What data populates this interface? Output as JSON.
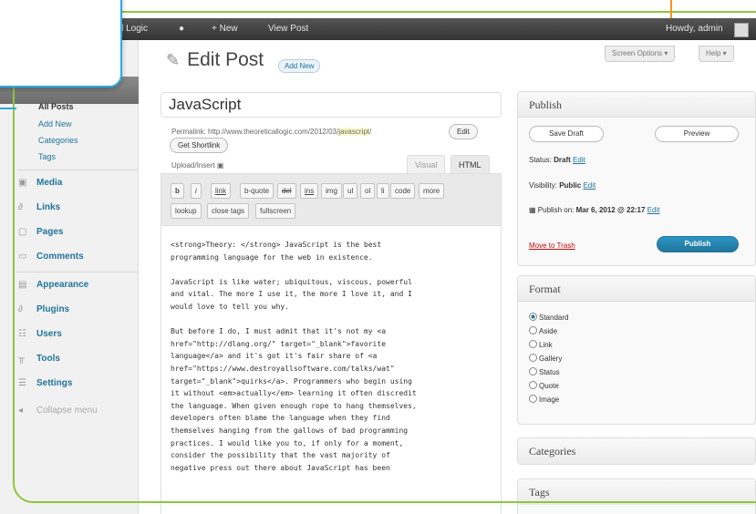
{
  "adminbar": {
    "site_name": "etical Logic",
    "comment_icon": "speech-bubble-icon",
    "new_label": "+ New",
    "view_post": "View Post",
    "howdy": "Howdy, admin"
  },
  "page": {
    "title": "Edit Post",
    "add_new": "Add New",
    "screen_options": "Screen Options ▾",
    "help": "Help ▾"
  },
  "post": {
    "title": "JavaScript",
    "permalink_prefix": "Permalink: http://www.theoreticallogic.com/2012/03/",
    "permalink_slug": "javascript",
    "permalink_suffix": "/",
    "edit_btn": "Edit",
    "shortlink_btn": "Get Shortlink",
    "upload_insert": "Upload/Insert",
    "tab_visual": "Visual",
    "tab_html": "HTML"
  },
  "quicktags": {
    "row1": [
      "b",
      "i",
      "link",
      "b-quote",
      "del",
      "ins",
      "img",
      "ul",
      "ol",
      "li",
      "code",
      "more"
    ],
    "row2": [
      "lookup",
      "close tags",
      "fullscreen"
    ]
  },
  "content": {
    "p1": "<strong>Theory: </strong> JavaScript is the best\nprogramming language for the web in existence.",
    "p2": "JavaScript is like water; ubiquitous, viscous, powerful\nand vital. The more I use it, the more I love it, and I\nwould love to tell you why.",
    "p3": "But before I do, I must admit that it's not my <a\nhref=\"http://dlang.org/\" target=\"_blank\">favorite\nlanguage</a> and it's got it's fair share of <a\nhref=\"https://www.destroyallsoftware.com/talks/wat\"\ntarget=\"_blank\">quirks</a>. Programmers who begin using\nit without <em>actually</em> learning it often discredit\nthe language. When given enough rope to hang themselves,\ndevelopers often blame the language when they find\nthemselves hanging from the gallows of bad programming\npractices. I would like you to, if only for a moment,\nconsider the possibility that the vast majority of\nnegative press out there about JavaScript has been"
  },
  "sidebar": {
    "posts_sub": [
      "All Posts",
      "Add New",
      "Categories",
      "Tags"
    ],
    "items": [
      {
        "label": "Media",
        "icon": "media-icon"
      },
      {
        "label": "Links",
        "icon": "links-icon"
      },
      {
        "label": "Pages",
        "icon": "pages-icon"
      },
      {
        "label": "Comments",
        "icon": "comments-icon"
      },
      {
        "label": "Appearance",
        "icon": "appearance-icon"
      },
      {
        "label": "Plugins",
        "icon": "plugins-icon"
      },
      {
        "label": "Users",
        "icon": "users-icon"
      },
      {
        "label": "Tools",
        "icon": "tools-icon"
      },
      {
        "label": "Settings",
        "icon": "settings-icon"
      }
    ],
    "collapse": "Collapse menu"
  },
  "publish": {
    "heading": "Publish",
    "save_draft": "Save Draft",
    "preview": "Preview",
    "status_label": "Status: ",
    "status_value": "Draft",
    "visibility_label": "Visibility: ",
    "visibility_value": "Public",
    "edit": "Edit",
    "publish_on_label": "Publish on: ",
    "publish_on_value": "Mar 6, 2012 @ 22:17",
    "move_to_trash": "Move to Trash",
    "publish_btn": "Publish"
  },
  "format": {
    "heading": "Format",
    "options": [
      "Standard",
      "Aside",
      "Link",
      "Gallery",
      "Status",
      "Quote",
      "Image"
    ],
    "selected": "Standard"
  },
  "categories": {
    "heading": "Categories"
  },
  "tags": {
    "heading": "Tags"
  },
  "colors": {
    "accent_blue": "#21759b",
    "frame_green": "#8dc63f",
    "popup_blue": "#29abe2",
    "trash_red": "#bc0b0b"
  }
}
